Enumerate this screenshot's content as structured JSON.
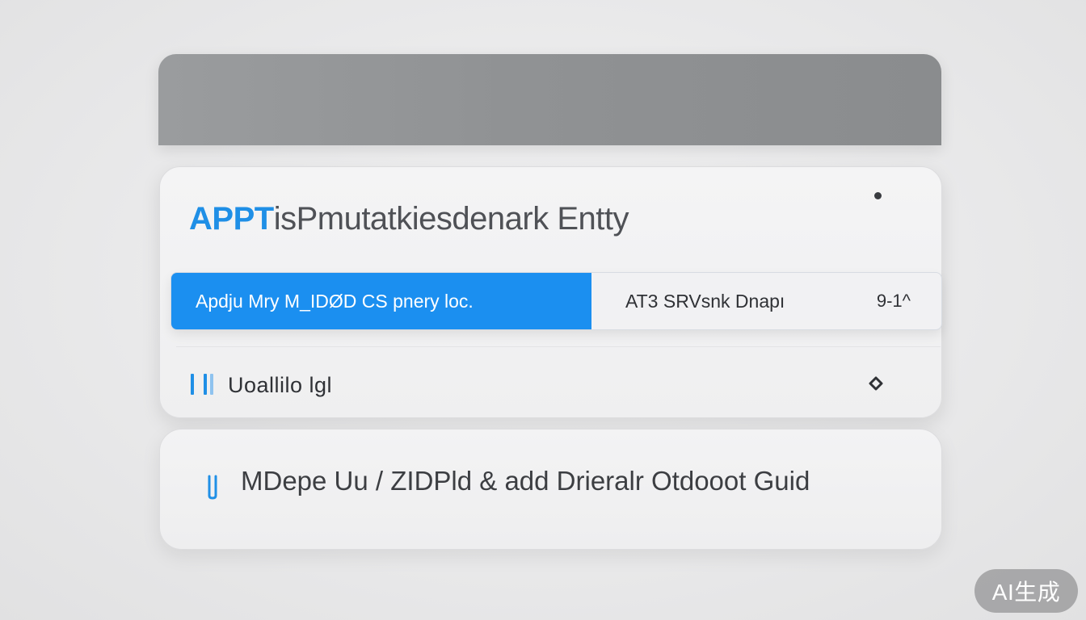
{
  "main_card": {
    "title_accent": "APPT",
    "title_rest": "isPmutatkiesdenark Entty",
    "segments": {
      "active_label": "Apdju Mry M_IDØD CS pnery loc.",
      "inactive_label": "AT3 SRVsnk Dnapı",
      "inactive_value": "9-1^"
    },
    "row": {
      "label": "Uoallilo lgl"
    }
  },
  "guide_card": {
    "text": "MDepe Uu / ZIDPld & add Drieralr Otdooot Guid"
  },
  "watermark": {
    "label": "AI生成"
  },
  "colors": {
    "accent": "#1b8ff0",
    "header": "#909294",
    "text": "#2f3135"
  },
  "icons": {
    "header_dot": "dot-icon",
    "row_bars": "bars-icon",
    "row_diamond": "diamond-icon",
    "guide": "link-icon"
  }
}
